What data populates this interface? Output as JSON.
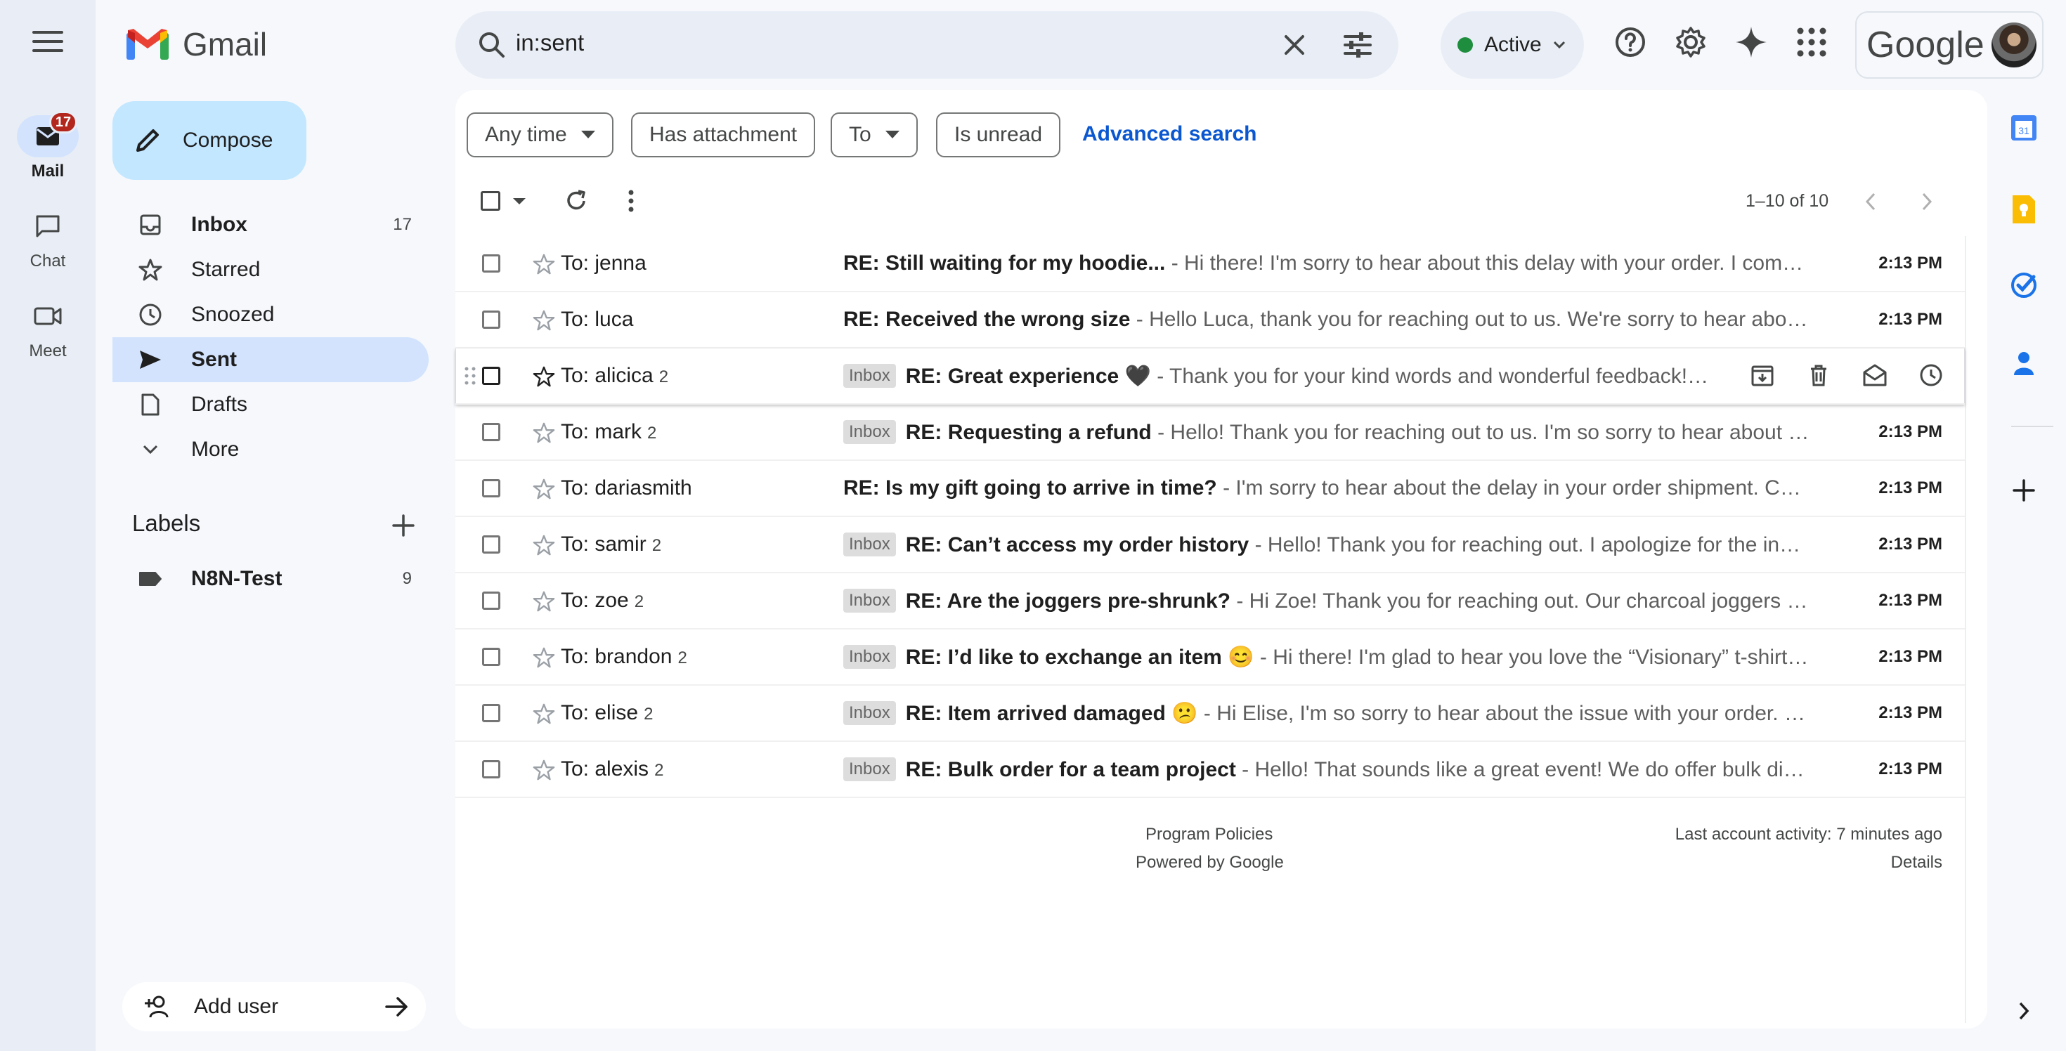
{
  "rail": {
    "mail_label": "Mail",
    "mail_badge": "17",
    "chat_label": "Chat",
    "meet_label": "Meet"
  },
  "logo": {
    "text": "Gmail"
  },
  "search": {
    "value": "in:sent"
  },
  "status": {
    "label": "Active"
  },
  "account": {
    "brand": "Google"
  },
  "sidebar": {
    "compose": "Compose",
    "items": [
      {
        "label": "Inbox",
        "count": "17"
      },
      {
        "label": "Starred",
        "count": ""
      },
      {
        "label": "Snoozed",
        "count": ""
      },
      {
        "label": "Sent",
        "count": ""
      },
      {
        "label": "Drafts",
        "count": ""
      },
      {
        "label": "More",
        "count": ""
      }
    ],
    "labels_title": "Labels",
    "labels": [
      {
        "name": "N8N-Test",
        "count": "9"
      }
    ],
    "add_user": "Add user"
  },
  "filters": {
    "any_time": "Any time",
    "has_attachment": "Has attachment",
    "to": "To",
    "is_unread": "Is unread",
    "advanced": "Advanced search"
  },
  "pager": {
    "text": "1–10 of 10"
  },
  "emails": [
    {
      "to": "To: jenna",
      "count": "",
      "tag": "",
      "subject": "RE: Still waiting for my hoodie...",
      "snippet": " - Hi there! I'm sorry to hear about this delay with your order. I completely understand how frustrating this must be",
      "time": "2:13 PM"
    },
    {
      "to": "To: luca",
      "count": "",
      "tag": "",
      "subject": "RE: Received the wrong size",
      "snippet": " - Hello Luca, thank you for reaching out to us. We're sorry to hear about the mix-up with your order",
      "time": "2:13 PM"
    },
    {
      "to": "To: alicica",
      "count": "2",
      "tag": "Inbox",
      "subject": "RE: Great experience 🖤",
      "snippet": " - Thank you for your kind words and wonderful feedback! We are thrilled",
      "time": ""
    },
    {
      "to": "To: mark",
      "count": "2",
      "tag": "Inbox",
      "subject": "RE: Requesting a refund",
      "snippet": " - Hello! Thank you for reaching out to us. I'm so sorry to hear about the damaged item",
      "time": "2:13 PM"
    },
    {
      "to": "To: dariasmith",
      "count": "",
      "tag": "",
      "subject": "RE: Is my gift going to arrive in time?",
      "snippet": " - I'm sorry to hear about the delay in your order shipment. Can you share your order number",
      "time": "2:13 PM"
    },
    {
      "to": "To: samir",
      "count": "2",
      "tag": "Inbox",
      "subject": "RE: Can’t access my order history",
      "snippet": " - Hello! Thank you for reaching out. I apologize for the inconvenience you are experiencing",
      "time": "2:13 PM"
    },
    {
      "to": "To: zoe",
      "count": "2",
      "tag": "Inbox",
      "subject": "RE: Are the joggers pre-shrunk?",
      "snippet": " - Hi Zoe! Thank you for reaching out. Our charcoal joggers are not pre-shrunk",
      "time": "2:13 PM"
    },
    {
      "to": "To: brandon",
      "count": "2",
      "tag": "Inbox",
      "subject": "RE: I’d like to exchange an item 😊",
      "snippet": " - Hi there! I'm glad to hear you love the “Visionary” t-shirt! We would be happy to help",
      "time": "2:13 PM"
    },
    {
      "to": "To: elise",
      "count": "2",
      "tag": "Inbox",
      "subject": "RE: Item arrived damaged 😕",
      "snippet": " - Hi Elise, I'm so sorry to hear about the issue with your order. We apologize for the trouble",
      "time": "2:13 PM"
    },
    {
      "to": "To: alexis",
      "count": "2",
      "tag": "Inbox",
      "subject": "RE: Bulk order for a team project",
      "snippet": " - Hello! That sounds like a great event! We do offer bulk discounts for larger orders",
      "time": "2:13 PM"
    }
  ],
  "footer": {
    "policies": "Program Policies",
    "powered": "Powered by Google",
    "activity": "Last account activity: 7 minutes ago",
    "details": "Details"
  }
}
